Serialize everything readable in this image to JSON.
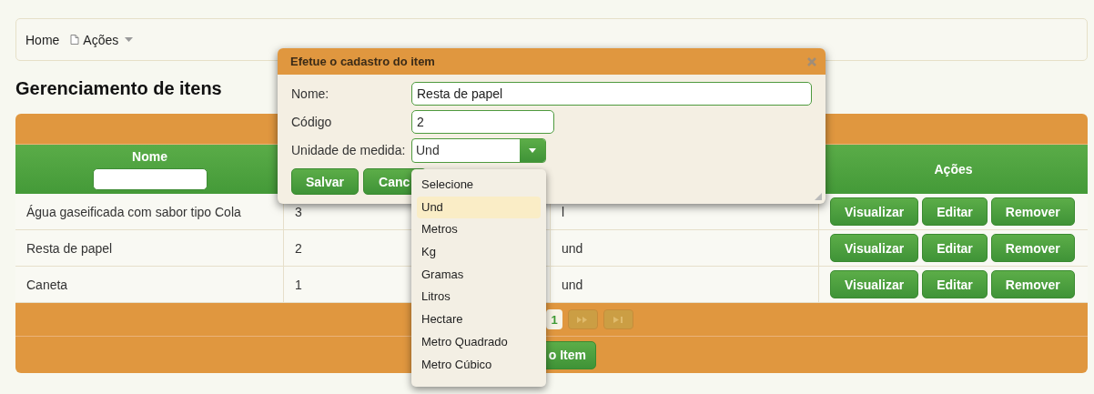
{
  "breadcrumb": [
    {
      "label": "Home",
      "kind": "link"
    },
    {
      "label": "Ações",
      "kind": "menu"
    }
  ],
  "page_title": "Gerenciamento de itens",
  "table": {
    "columns": [
      {
        "label": "Nome",
        "kind": "filter"
      },
      {
        "kind": "covered"
      },
      {
        "kind": "covered"
      },
      {
        "label": "Ações",
        "kind": "plain"
      }
    ],
    "rows": [
      {
        "cells": [
          "Água gaseificada com sabor tipo Cola",
          "3",
          "l"
        ],
        "actions": [
          "Visualizar",
          "Editar",
          "Remover"
        ]
      },
      {
        "cells": [
          "Resta de papel",
          "2",
          "und"
        ],
        "actions": [
          "Visualizar",
          "Editar",
          "Remover"
        ]
      },
      {
        "cells": [
          "Caneta",
          "1",
          "und"
        ],
        "actions": [
          "Visualizar",
          "Editar",
          "Remover"
        ]
      }
    ],
    "pager": {
      "pages": [
        {
          "label": "1",
          "selected": true
        }
      ],
      "next_disabled": true,
      "last_disabled": true
    },
    "footer_button": "o Item"
  },
  "dialog": {
    "title": "Efetue o cadastro do item",
    "fields": [
      {
        "label": "Nome:",
        "value": "Resta de papel",
        "kind": "text"
      },
      {
        "label": "Código",
        "value": "2",
        "kind": "text"
      },
      {
        "label": "Unidade de medida:",
        "value": "Und",
        "kind": "select"
      }
    ],
    "buttons": [
      "Salvar",
      "Canc"
    ]
  },
  "dropdown": {
    "options": [
      {
        "label": "Selecione",
        "selected": false
      },
      {
        "label": "Und",
        "selected": true
      },
      {
        "label": "Metros",
        "selected": false
      },
      {
        "label": "Kg",
        "selected": false
      },
      {
        "label": "Gramas",
        "selected": false
      },
      {
        "label": "Litros",
        "selected": false
      },
      {
        "label": "Hectare",
        "selected": false
      },
      {
        "label": "Metro Quadrado",
        "selected": false
      },
      {
        "label": "Metro Cúbico",
        "selected": false
      }
    ]
  }
}
